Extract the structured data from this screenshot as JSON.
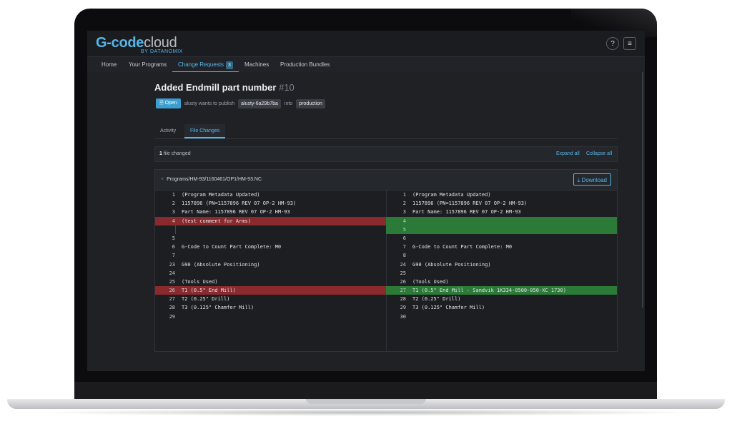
{
  "app": {
    "logo_main": "G-code",
    "logo_cloud": "cloud",
    "logo_byline": "BY DATANOMIX",
    "help_icon": "?",
    "menu_icon": "≡"
  },
  "nav": {
    "items": [
      {
        "label": "Home"
      },
      {
        "label": "Your Programs"
      },
      {
        "label": "Change Requests",
        "badge": "3",
        "active": true
      },
      {
        "label": "Machines"
      },
      {
        "label": "Production Bundles"
      }
    ]
  },
  "change_request": {
    "title": "Added Endmill part number",
    "number": "#10",
    "status": "Open",
    "author_text": "alusty wants to publish",
    "branch": "alusty-6a29b7ba",
    "into_text": "into",
    "target": "production"
  },
  "tabs": [
    {
      "label": "Activity"
    },
    {
      "label": "File Changes",
      "active": true
    }
  ],
  "summary": {
    "count": "1",
    "count_text": "file changed",
    "expand_all": "Expand all",
    "collapse_all": "Collapse all"
  },
  "file": {
    "path": "Programs/HM-93/1160461/OP1/HM-93.NC",
    "download_label": "Download",
    "left": [
      {
        "n": "1",
        "code": "(Program Metadata Updated)",
        "type": ""
      },
      {
        "n": "2",
        "code": "1157896 (PN=1157896 REV 07 OP-2 HM-93)",
        "type": ""
      },
      {
        "n": "3",
        "code": "Part Name: 1157896 REV 07 OP-2 HM-93",
        "type": ""
      },
      {
        "n": "4",
        "code": "(test comment for Arms)",
        "type": "del"
      },
      {
        "n": "",
        "code": "",
        "type": "delgap"
      },
      {
        "n": "5",
        "code": "",
        "type": ""
      },
      {
        "n": "6",
        "code": "G-Code to Count Part Complete: M0",
        "type": ""
      },
      {
        "n": "7",
        "code": "",
        "type": ""
      },
      {
        "n": "23",
        "code": "G90 (Absolute Positioning)",
        "type": ""
      },
      {
        "n": "24",
        "code": "",
        "type": ""
      },
      {
        "n": "25",
        "code": "(Tools Used)",
        "type": ""
      },
      {
        "n": "26",
        "code": "T1 (0.5\" End Mill)",
        "type": "del"
      },
      {
        "n": "27",
        "code": "T2 (0.25\" Drill)",
        "type": ""
      },
      {
        "n": "28",
        "code": "T3 (0.125\" Chamfer Mill)",
        "type": ""
      },
      {
        "n": "29",
        "code": "",
        "type": ""
      }
    ],
    "right": [
      {
        "n": "1",
        "code": "(Program Metadata Updated)",
        "type": ""
      },
      {
        "n": "2",
        "code": "1157896 (PN=1157896 REV 07 OP-2 HM-93)",
        "type": ""
      },
      {
        "n": "3",
        "code": "Part Name: 1157896 REV 07 OP-2 HM-93",
        "type": ""
      },
      {
        "n": "4",
        "code": "",
        "type": "add"
      },
      {
        "n": "5",
        "code": "",
        "type": "add"
      },
      {
        "n": "6",
        "code": "",
        "type": ""
      },
      {
        "n": "7",
        "code": "G-Code to Count Part Complete: M0",
        "type": ""
      },
      {
        "n": "8",
        "code": "",
        "type": ""
      },
      {
        "n": "24",
        "code": "G90 (Absolute Positioning)",
        "type": ""
      },
      {
        "n": "25",
        "code": "",
        "type": ""
      },
      {
        "n": "26",
        "code": "(Tools Used)",
        "type": ""
      },
      {
        "n": "27",
        "code": "T1 (0.5\" End Mill - Sandvik 1K334-0500-050-XC 1730)",
        "type": "add"
      },
      {
        "n": "28",
        "code": "T2 (0.25\" Drill)",
        "type": ""
      },
      {
        "n": "29",
        "code": "T3 (0.125\" Chamfer Mill)",
        "type": ""
      },
      {
        "n": "30",
        "code": "",
        "type": ""
      }
    ]
  },
  "colors": {
    "accent": "#55b7e8",
    "deleted": "#8a2a2e",
    "added": "#2b7a38",
    "background": "#1f2125"
  }
}
